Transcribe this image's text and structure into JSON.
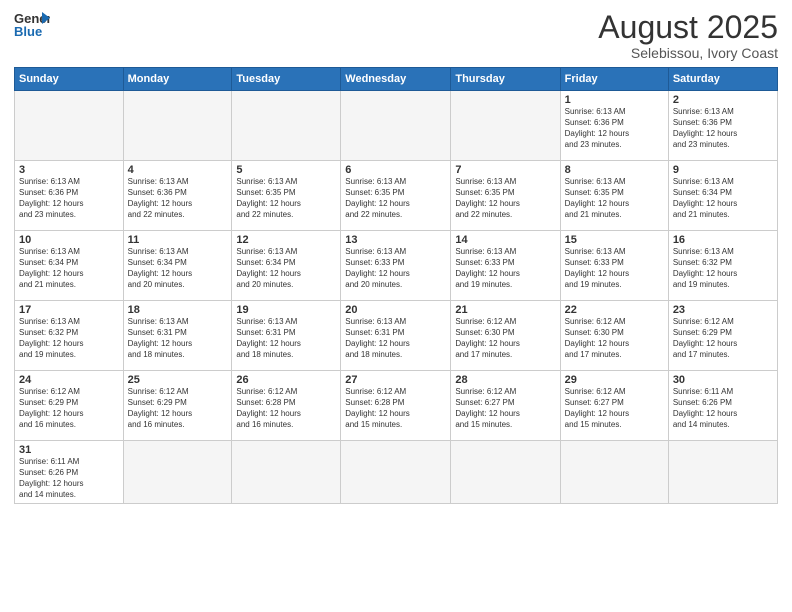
{
  "header": {
    "logo_general": "General",
    "logo_blue": "Blue",
    "title": "August 2025",
    "subtitle": "Selebissou, Ivory Coast"
  },
  "weekdays": [
    "Sunday",
    "Monday",
    "Tuesday",
    "Wednesday",
    "Thursday",
    "Friday",
    "Saturday"
  ],
  "weeks": [
    [
      {
        "day": "",
        "info": ""
      },
      {
        "day": "",
        "info": ""
      },
      {
        "day": "",
        "info": ""
      },
      {
        "day": "",
        "info": ""
      },
      {
        "day": "",
        "info": ""
      },
      {
        "day": "1",
        "info": "Sunrise: 6:13 AM\nSunset: 6:36 PM\nDaylight: 12 hours\nand 23 minutes."
      },
      {
        "day": "2",
        "info": "Sunrise: 6:13 AM\nSunset: 6:36 PM\nDaylight: 12 hours\nand 23 minutes."
      }
    ],
    [
      {
        "day": "3",
        "info": "Sunrise: 6:13 AM\nSunset: 6:36 PM\nDaylight: 12 hours\nand 23 minutes."
      },
      {
        "day": "4",
        "info": "Sunrise: 6:13 AM\nSunset: 6:36 PM\nDaylight: 12 hours\nand 22 minutes."
      },
      {
        "day": "5",
        "info": "Sunrise: 6:13 AM\nSunset: 6:35 PM\nDaylight: 12 hours\nand 22 minutes."
      },
      {
        "day": "6",
        "info": "Sunrise: 6:13 AM\nSunset: 6:35 PM\nDaylight: 12 hours\nand 22 minutes."
      },
      {
        "day": "7",
        "info": "Sunrise: 6:13 AM\nSunset: 6:35 PM\nDaylight: 12 hours\nand 22 minutes."
      },
      {
        "day": "8",
        "info": "Sunrise: 6:13 AM\nSunset: 6:35 PM\nDaylight: 12 hours\nand 21 minutes."
      },
      {
        "day": "9",
        "info": "Sunrise: 6:13 AM\nSunset: 6:34 PM\nDaylight: 12 hours\nand 21 minutes."
      }
    ],
    [
      {
        "day": "10",
        "info": "Sunrise: 6:13 AM\nSunset: 6:34 PM\nDaylight: 12 hours\nand 21 minutes."
      },
      {
        "day": "11",
        "info": "Sunrise: 6:13 AM\nSunset: 6:34 PM\nDaylight: 12 hours\nand 20 minutes."
      },
      {
        "day": "12",
        "info": "Sunrise: 6:13 AM\nSunset: 6:34 PM\nDaylight: 12 hours\nand 20 minutes."
      },
      {
        "day": "13",
        "info": "Sunrise: 6:13 AM\nSunset: 6:33 PM\nDaylight: 12 hours\nand 20 minutes."
      },
      {
        "day": "14",
        "info": "Sunrise: 6:13 AM\nSunset: 6:33 PM\nDaylight: 12 hours\nand 19 minutes."
      },
      {
        "day": "15",
        "info": "Sunrise: 6:13 AM\nSunset: 6:33 PM\nDaylight: 12 hours\nand 19 minutes."
      },
      {
        "day": "16",
        "info": "Sunrise: 6:13 AM\nSunset: 6:32 PM\nDaylight: 12 hours\nand 19 minutes."
      }
    ],
    [
      {
        "day": "17",
        "info": "Sunrise: 6:13 AM\nSunset: 6:32 PM\nDaylight: 12 hours\nand 19 minutes."
      },
      {
        "day": "18",
        "info": "Sunrise: 6:13 AM\nSunset: 6:31 PM\nDaylight: 12 hours\nand 18 minutes."
      },
      {
        "day": "19",
        "info": "Sunrise: 6:13 AM\nSunset: 6:31 PM\nDaylight: 12 hours\nand 18 minutes."
      },
      {
        "day": "20",
        "info": "Sunrise: 6:13 AM\nSunset: 6:31 PM\nDaylight: 12 hours\nand 18 minutes."
      },
      {
        "day": "21",
        "info": "Sunrise: 6:12 AM\nSunset: 6:30 PM\nDaylight: 12 hours\nand 17 minutes."
      },
      {
        "day": "22",
        "info": "Sunrise: 6:12 AM\nSunset: 6:30 PM\nDaylight: 12 hours\nand 17 minutes."
      },
      {
        "day": "23",
        "info": "Sunrise: 6:12 AM\nSunset: 6:29 PM\nDaylight: 12 hours\nand 17 minutes."
      }
    ],
    [
      {
        "day": "24",
        "info": "Sunrise: 6:12 AM\nSunset: 6:29 PM\nDaylight: 12 hours\nand 16 minutes."
      },
      {
        "day": "25",
        "info": "Sunrise: 6:12 AM\nSunset: 6:29 PM\nDaylight: 12 hours\nand 16 minutes."
      },
      {
        "day": "26",
        "info": "Sunrise: 6:12 AM\nSunset: 6:28 PM\nDaylight: 12 hours\nand 16 minutes."
      },
      {
        "day": "27",
        "info": "Sunrise: 6:12 AM\nSunset: 6:28 PM\nDaylight: 12 hours\nand 15 minutes."
      },
      {
        "day": "28",
        "info": "Sunrise: 6:12 AM\nSunset: 6:27 PM\nDaylight: 12 hours\nand 15 minutes."
      },
      {
        "day": "29",
        "info": "Sunrise: 6:12 AM\nSunset: 6:27 PM\nDaylight: 12 hours\nand 15 minutes."
      },
      {
        "day": "30",
        "info": "Sunrise: 6:11 AM\nSunset: 6:26 PM\nDaylight: 12 hours\nand 14 minutes."
      }
    ],
    [
      {
        "day": "31",
        "info": "Sunrise: 6:11 AM\nSunset: 6:26 PM\nDaylight: 12 hours\nand 14 minutes."
      },
      {
        "day": "",
        "info": ""
      },
      {
        "day": "",
        "info": ""
      },
      {
        "day": "",
        "info": ""
      },
      {
        "day": "",
        "info": ""
      },
      {
        "day": "",
        "info": ""
      },
      {
        "day": "",
        "info": ""
      }
    ]
  ]
}
